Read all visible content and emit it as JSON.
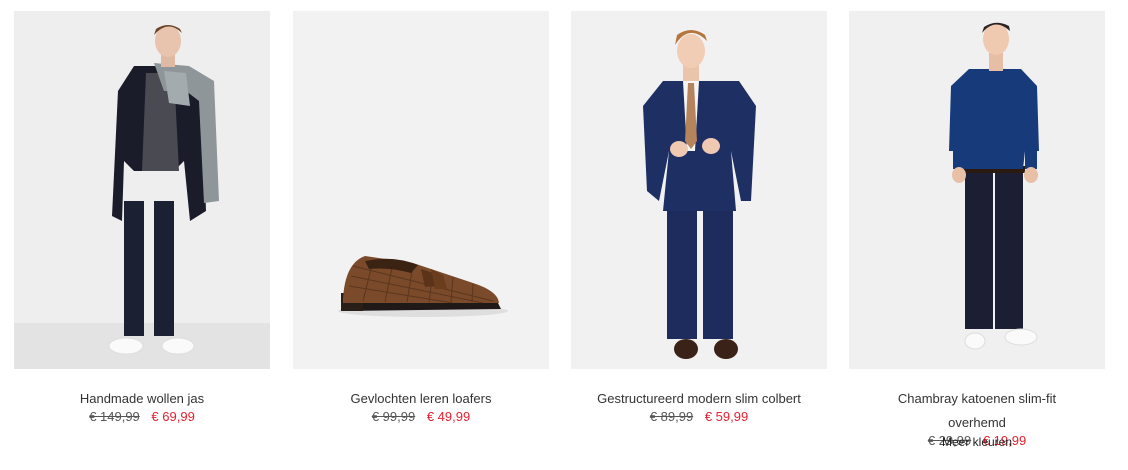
{
  "products": [
    {
      "name": "Handmade wollen jas",
      "old_price": "€ 149,99",
      "new_price": "€ 69,99"
    },
    {
      "name": "Gevlochten leren loafers",
      "old_price": "€ 99,99",
      "new_price": "€ 49,99"
    },
    {
      "name": "Gestructureerd modern slim colbert",
      "old_price": "€ 89,99",
      "new_price": "€ 59,99"
    },
    {
      "name": "Chambray katoenen slim-fit overhemd",
      "old_price": "€ 29,99",
      "new_price": "€ 19,99",
      "more_colors": "Meer kleuren"
    }
  ],
  "colors": {
    "sale_price": "#e5202e",
    "image_background": "#f1f1f1"
  }
}
